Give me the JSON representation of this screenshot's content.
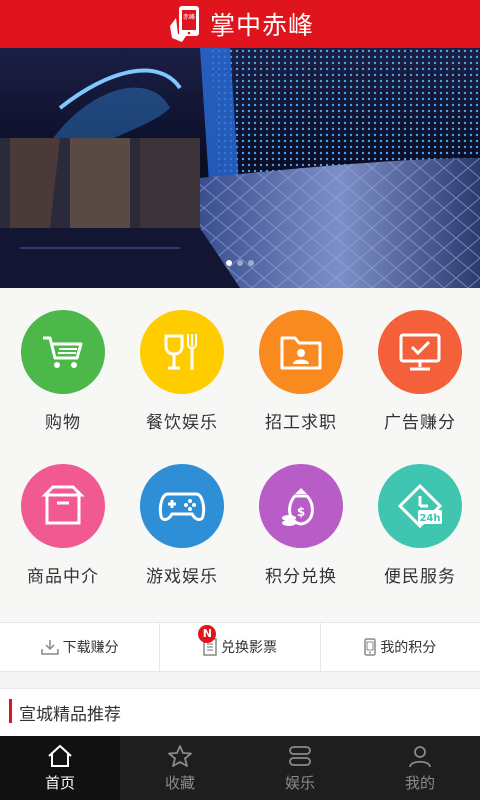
{
  "header": {
    "title": "掌中赤峰",
    "logo_text": "赤峰"
  },
  "banner": {
    "slide_count": 3,
    "active_slide": 1
  },
  "categories": [
    {
      "label": "购物",
      "color": "#4cb849",
      "icon": "shopping-cart-icon"
    },
    {
      "label": "餐饮娱乐",
      "color": "#ffcc00",
      "icon": "dining-icon"
    },
    {
      "label": "招工求职",
      "color": "#f98a20",
      "icon": "job-folder-icon"
    },
    {
      "label": "广告赚分",
      "color": "#f4603a",
      "icon": "monitor-check-icon"
    },
    {
      "label": "商品中介",
      "color": "#f05a90",
      "icon": "box-icon"
    },
    {
      "label": "游戏娱乐",
      "color": "#2f8fd6",
      "icon": "gamepad-icon"
    },
    {
      "label": "积分兑换",
      "color": "#b85cc8",
      "icon": "money-bag-icon"
    },
    {
      "label": "便民服务",
      "color": "#40c6b0",
      "icon": "clock-24h-icon"
    }
  ],
  "actions": [
    {
      "label": "下载赚分",
      "icon": "download-icon"
    },
    {
      "label": "兑换影票",
      "icon": "ticket-icon",
      "badge": "N"
    },
    {
      "label": "我的积分",
      "icon": "phone-icon"
    }
  ],
  "section": {
    "title": "宣城精品推荐"
  },
  "tabs": [
    {
      "label": "首页",
      "icon": "home-icon",
      "active": true
    },
    {
      "label": "收藏",
      "icon": "star-icon",
      "active": false
    },
    {
      "label": "娱乐",
      "icon": "entertainment-icon",
      "active": false
    },
    {
      "label": "我的",
      "icon": "user-icon",
      "active": false
    }
  ],
  "colors": {
    "brand": "#e0141c",
    "tabbar": "#1e1e1e"
  }
}
